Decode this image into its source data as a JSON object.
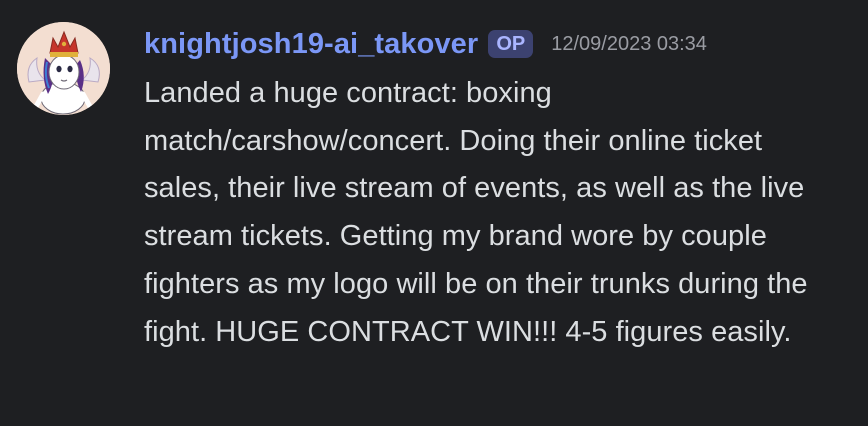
{
  "message": {
    "author": "knightjosh19-ai_takover",
    "badge": "OP",
    "timestamp": "12/09/2023 03:34",
    "text": "Landed a huge contract: boxing match/carshow/concert. Doing their online ticket sales, their live stream of events, as well as the live stream tickets. Getting my brand wore by couple fighters as my logo will be on their trunks during the fight. HUGE CONTRACT WIN!!! 4-5 figures easily."
  },
  "colors": {
    "background": "#1e1f22",
    "username": "#7b97f6",
    "badge_bg": "#3c4270",
    "badge_text": "#aab5ff",
    "timestamp": "#9a9ca3",
    "text": "#dbdee1"
  },
  "icons": {
    "avatar": "pony-avatar-icon"
  }
}
